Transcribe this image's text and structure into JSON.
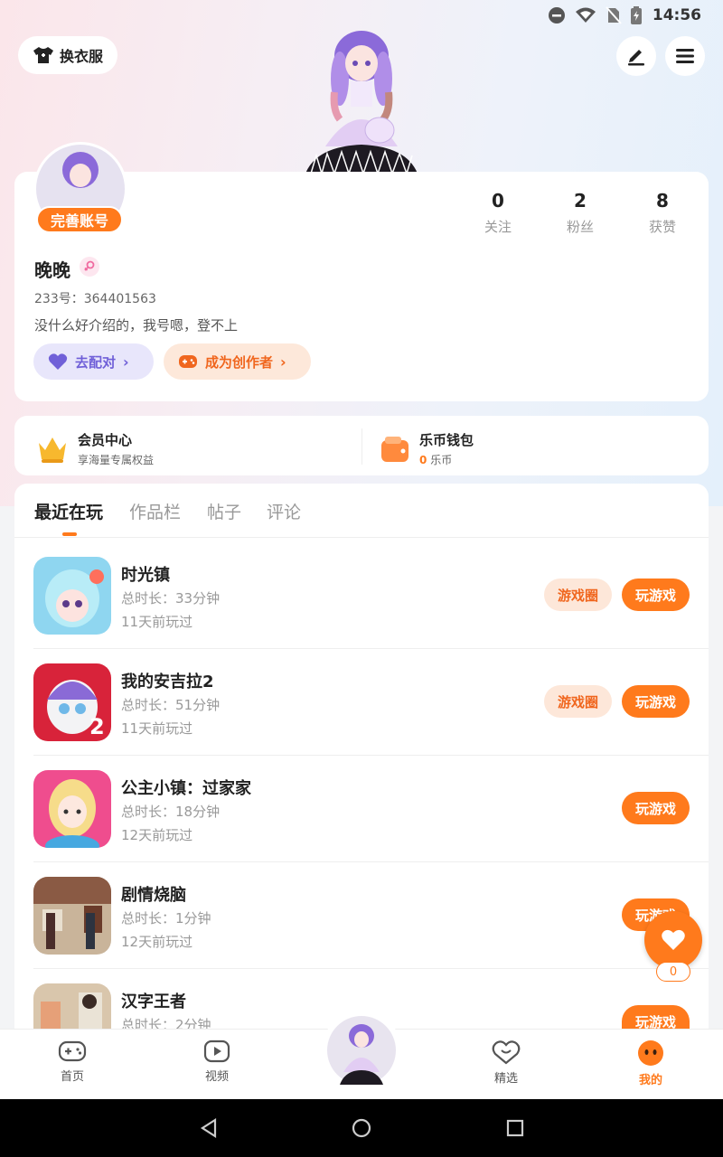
{
  "status_bar": {
    "time": "14:56"
  },
  "header": {
    "wardrobe_label": "换衣服"
  },
  "profile": {
    "complete_badge": "完善账号",
    "stats": [
      {
        "value": "0",
        "label": "关注"
      },
      {
        "value": "2",
        "label": "粉丝"
      },
      {
        "value": "8",
        "label": "获赞"
      }
    ],
    "username": "晚晚",
    "uid": "233号：364401563",
    "bio": "没什么好介绍的，我号嗯，登不上",
    "match_label": "去配对",
    "creator_label": "成为创作者"
  },
  "vip": {
    "member_title": "会员中心",
    "member_sub": "享海量专属权益",
    "wallet_title": "乐币钱包",
    "wallet_amount": "0",
    "wallet_unit": "乐币"
  },
  "tabs": [
    "最近在玩",
    "作品栏",
    "帖子",
    "评论"
  ],
  "games": [
    {
      "title": "时光镇",
      "duration": "总时长：33分钟",
      "last": "11天前玩过",
      "circle": "游戏圈",
      "play": "玩游戏"
    },
    {
      "title": "我的安吉拉2",
      "duration": "总时长：51分钟",
      "last": "11天前玩过",
      "circle": "游戏圈",
      "play": "玩游戏"
    },
    {
      "title": "公主小镇：过家家",
      "duration": "总时长：18分钟",
      "last": "12天前玩过",
      "play": "玩游戏"
    },
    {
      "title": "剧情烧脑",
      "duration": "总时长：1分钟",
      "last": "12天前玩过",
      "play": "玩游戏"
    },
    {
      "title": "汉字王者",
      "duration": "总时长：2分钟",
      "play": "玩游戏"
    }
  ],
  "fab": {
    "count": "0"
  },
  "nav": {
    "home": "首页",
    "video": "视频",
    "featured": "精选",
    "mine": "我的"
  },
  "colors": {
    "accent": "#ff7a1c",
    "purple": "#7060d8"
  }
}
